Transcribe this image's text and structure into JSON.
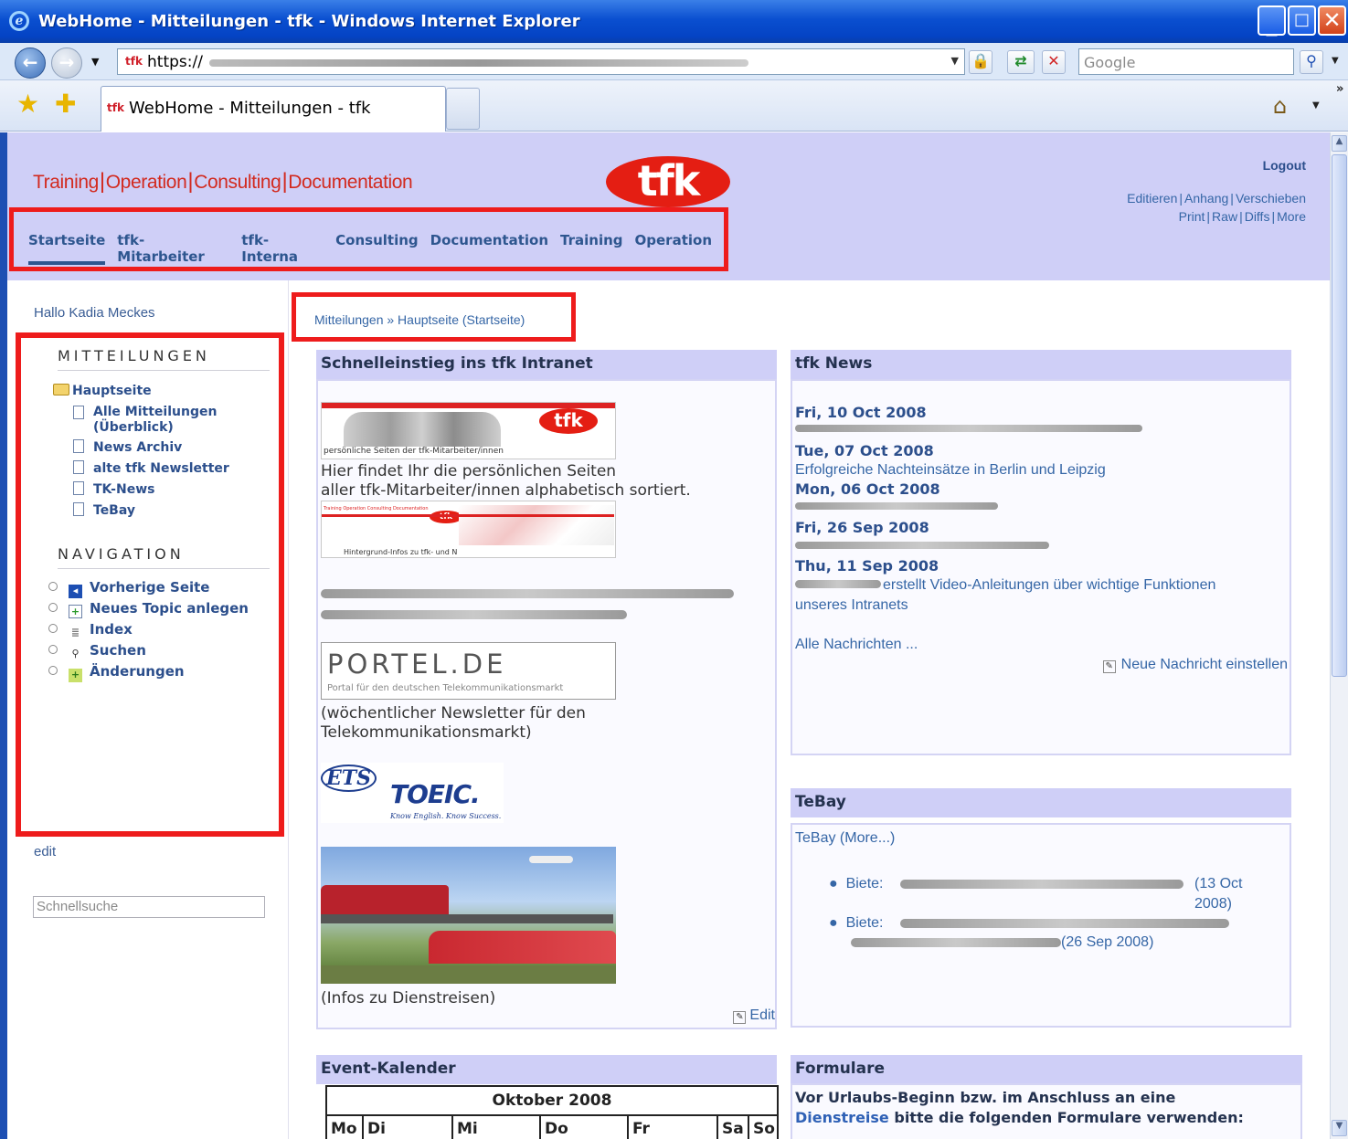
{
  "window": {
    "title": "WebHome - Mitteilungen - tfk - Windows Internet Explorer"
  },
  "address_bar": {
    "favicon_text": "tfk",
    "url": "https://",
    "search_placeholder": "Google"
  },
  "tab": {
    "favicon_text": "tfk",
    "title": "WebHome - Mitteilungen - tfk"
  },
  "site_header": {
    "tagline": [
      "Training",
      "Operation",
      "Consulting",
      "Documentation"
    ],
    "logo_text": "tfk",
    "logout": "Logout",
    "actions_row1": [
      "Editieren",
      "Anhang",
      "Verschieben"
    ],
    "actions_row2": [
      "Print",
      "Raw",
      "Diffs",
      "More"
    ],
    "topnav": [
      "Startseite",
      "tfk-Mitarbeiter",
      "tfk-Interna",
      "Consulting",
      "Documentation",
      "Training",
      "Operation"
    ]
  },
  "sidebar": {
    "greeting": "Hallo Kadia Meckes",
    "mitteilungen_heading": "MITTEILUNGEN",
    "root_item": "Hauptseite",
    "items": [
      "Alle Mitteilungen\n(Überblick)",
      "News Archiv",
      "alte tfk Newsletter",
      "TK-News",
      "TeBay"
    ],
    "navigation_heading": "NAVIGATION",
    "nav_items": [
      "Vorherige Seite",
      "Neues Topic anlegen",
      "Index",
      "Suchen",
      "Änderungen"
    ],
    "edit": "edit",
    "search_placeholder": "Schnellsuche"
  },
  "breadcrumb": {
    "text": "Mitteilungen » Hauptseite (Startseite)"
  },
  "schnelleinstieg": {
    "heading": "Schnelleinstieg ins tfk Intranet",
    "img1_caption": "persönliche Seiten der tfk-Mitarbeiter/innen",
    "img1_logo": "tfk",
    "text1_line1": "Hier findet Ihr die persönlichen Seiten",
    "text1_line2": "aller tfk-Mitarbeiter/innen alphabetisch sortiert.",
    "img2_caption": "Hintergrund-Infos zu tfk- und N",
    "img2_header": "Training Operation Consulting Documentation",
    "portel_logo": "PORTEL.DE",
    "portel_sub": "Portal für den deutschen Telekommunikationsmarkt",
    "portel_text": "(wöchentlicher Newsletter für den\nTelekommunikationsmarkt)",
    "ets": "ETS",
    "toeic": "TOEIC.",
    "toeic_sub": "Know English. Know Success.",
    "dienstreisen": "(Infos zu Dienstreisen)",
    "edit": "Edit"
  },
  "news": {
    "heading": "tfk News",
    "entries": [
      {
        "date": "Fri, 10 Oct 2008",
        "text": ""
      },
      {
        "date": "Tue, 07 Oct 2008",
        "text": "Erfolgreiche Nachteinsätze in Berlin und Leipzig"
      },
      {
        "date": "Mon, 06 Oct 2008",
        "text": ""
      },
      {
        "date": "Fri, 26 Sep 2008",
        "text": ""
      },
      {
        "date": "Thu, 11 Sep 2008",
        "text": "erstellt Video-Anleitungen über wichtige Funktionen\nunseres Intranets"
      }
    ],
    "all_news": "Alle Nachrichten ...",
    "new_news": "Neue Nachricht einstellen"
  },
  "tebay": {
    "heading": "TeBay",
    "link": "TeBay",
    "more": "(More...)",
    "items": [
      {
        "prefix": "Biete:",
        "date": "(13 Oct\n2008)"
      },
      {
        "prefix": "Biete:",
        "date": "(26 Sep 2008)"
      }
    ]
  },
  "event_kalender": {
    "heading": "Event-Kalender",
    "month": "Oktober 2008",
    "days": [
      "Mo",
      "Di",
      "Mi",
      "Do",
      "Fr",
      "Sa",
      "So"
    ]
  },
  "formulare": {
    "heading": "Formulare",
    "text_part1": "Vor Urlaubs-Beginn bzw. im Anschluss an eine",
    "link": "Dienstreise",
    "text_part2": "bitte die folgenden Formulare verwenden:"
  }
}
